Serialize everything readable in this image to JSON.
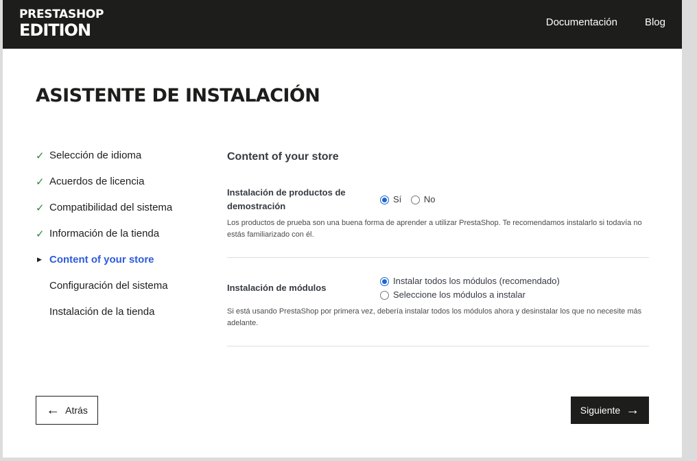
{
  "header": {
    "logo_top": "PRESTASHOP",
    "logo_bottom": "EDITION",
    "nav": [
      "Documentación",
      "Blog"
    ]
  },
  "title": "ASISTENTE DE INSTALACIÓN",
  "steps": [
    {
      "label": "Selección de idioma",
      "state": "done"
    },
    {
      "label": "Acuerdos de licencia",
      "state": "done"
    },
    {
      "label": "Compatibilidad del sistema",
      "state": "done"
    },
    {
      "label": "Información de la tienda",
      "state": "done"
    },
    {
      "label": "Content of your store",
      "state": "active"
    },
    {
      "label": "Configuración del sistema",
      "state": "pending"
    },
    {
      "label": "Instalación de la tienda",
      "state": "pending"
    }
  ],
  "content": {
    "title": "Content of your store",
    "demo": {
      "label": "Instalación de productos de demostración",
      "options": [
        "Sí",
        "No"
      ],
      "selected": "Sí",
      "help": "Los productos de prueba son una buena forma de aprender a utilizar PrestaShop. Te recomendamos instalarlo si todavía no estás familiarizado con él."
    },
    "modules": {
      "label": "Instalación de módulos",
      "options": [
        "Instalar todos los módulos (recomendado)",
        "Seleccione los módulos a instalar"
      ],
      "selected": "Instalar todos los módulos (recomendado)",
      "help": "Si está usando PrestaShop por primera vez, debería instalar todos los módulos ahora y desinstalar los que no necesite más adelante."
    }
  },
  "buttons": {
    "back": "Atrás",
    "next": "Siguiente"
  },
  "colors": {
    "header_bg": "#1d1d1b",
    "active_step": "#2d5bd9",
    "check": "#2e8540",
    "radio": "#1a66d4"
  },
  "icons": {
    "done": "checkmark-icon",
    "active": "caret-right-icon",
    "back": "arrow-left-icon",
    "next": "arrow-right-icon"
  }
}
